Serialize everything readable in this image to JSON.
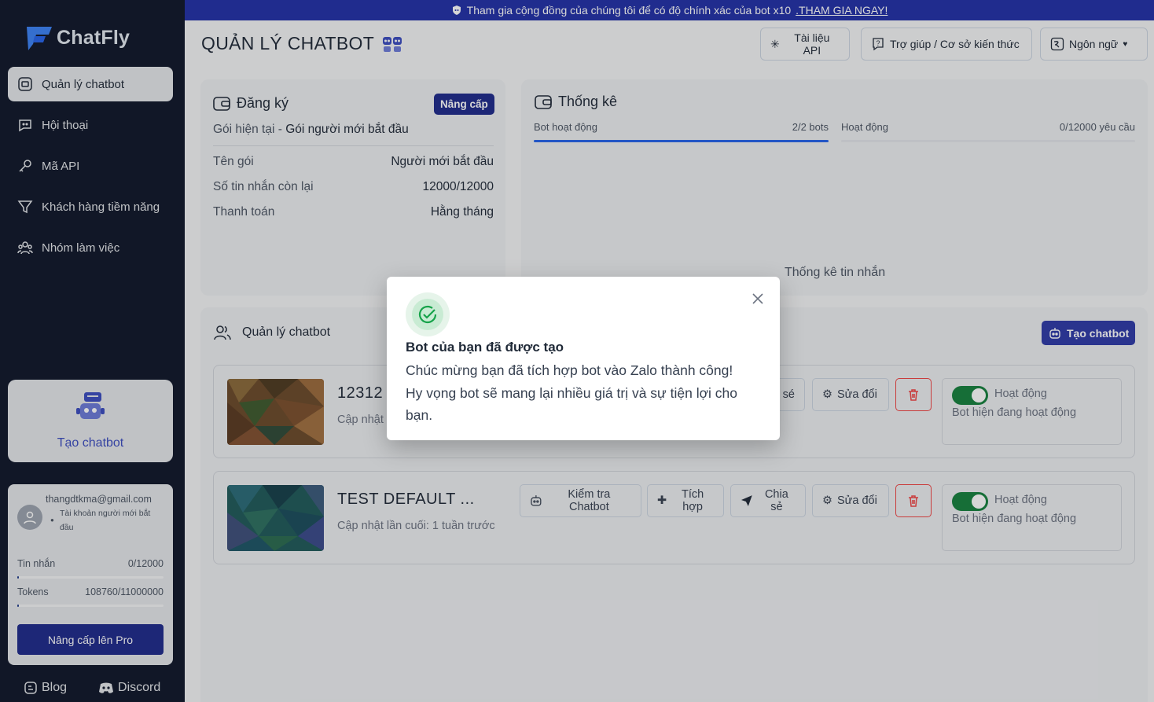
{
  "colors": {
    "sidebar_bg": "#0f172a",
    "banner_bg": "#2130a8",
    "primary": "#1e2a8c",
    "success": "#15803d",
    "danger": "#ef4444"
  },
  "app": {
    "name": "ChatFly"
  },
  "sidebar": {
    "items": [
      {
        "label": "Quản lý chatbot",
        "icon": "chatbot-box-icon"
      },
      {
        "label": "Hội thoại",
        "icon": "chat-bubble-icon"
      },
      {
        "label": "Mã API",
        "icon": "key-icon"
      },
      {
        "label": "Khách hàng tiềm năng",
        "icon": "filter-icon"
      },
      {
        "label": "Nhóm làm việc",
        "icon": "team-icon"
      }
    ],
    "create_card_label": "Tạo chatbot",
    "account": {
      "email": "thangdtkma@gmail.com",
      "plan": "Tài khoản người mới bắt đầu",
      "messages_label": "Tin nhắn",
      "messages_value": "0/12000",
      "messages_fraction": 0,
      "tokens_label": "Tokens",
      "tokens_value": "108760/11000000",
      "tokens_fraction": 0.0099,
      "upgrade_label": "Nâng cấp lên Pro"
    },
    "blog_label": "Blog",
    "discord_label": "Discord"
  },
  "banner": {
    "text": "Tham gia cộng đồng của chúng tôi để có độ chính xác của bot x10",
    "link": ".THAM GIA NGAY!"
  },
  "header": {
    "title": "QUẢN LÝ CHATBOT",
    "api_docs": "Tài liệu API",
    "help": "Trợ giúp / Cơ sở kiến thức",
    "language": "Ngôn ngữ"
  },
  "subscription": {
    "title": "Đăng ký",
    "upgrade_badge": "Nâng cấp",
    "current_prefix": "Gói hiện tại -",
    "current_plan": "Gói người mới bắt đầu",
    "rows": [
      {
        "label": "Tên gói",
        "value": "Người mới bắt đầu"
      },
      {
        "label": "Số tin nhắn còn lại",
        "value": "12000/12000"
      },
      {
        "label": "Thanh toán",
        "value": "Hằng tháng"
      }
    ]
  },
  "stats": {
    "title": "Thống kê",
    "active_bots_label": "Bot hoạt động",
    "active_bots_value": "2/2 bots",
    "active_bots_fraction": 1,
    "activity_label": "Hoạt động",
    "activity_value": "0/12000 yêu cầu",
    "activity_fraction": 0,
    "messages_stats": "Thống kê tin nhắn"
  },
  "bots_section": {
    "title": "Quản lý chatbot",
    "create_button": "Tạo chatbot",
    "bots": [
      {
        "name": "12312",
        "updated": "Cập nhật l",
        "actions": {
          "share": "sé",
          "edit": "Sửa đổi"
        },
        "status": "Hoạt động",
        "status_desc": "Bot hiện đang hoạt động",
        "active": true
      },
      {
        "name": "TEST DEFAULT ...",
        "updated": "Cập nhật lần cuối: 1 tuần trước",
        "actions": {
          "test": "Kiểm tra Chatbot",
          "integrate": "Tích hợp",
          "share": "Chia sẻ",
          "edit": "Sửa đổi"
        },
        "status": "Hoạt động",
        "status_desc": "Bot hiện đang hoạt động",
        "active": true
      }
    ]
  },
  "modal": {
    "title": "Bot của bạn đã được tạo",
    "body_line1": "Chúc mừng bạn đã tích hợp bot vào Zalo thành công!",
    "body_line2": "Hy vọng bot sẽ mang lại nhiều giá trị và sự tiện lợi cho",
    "body_line3": "bạn."
  }
}
